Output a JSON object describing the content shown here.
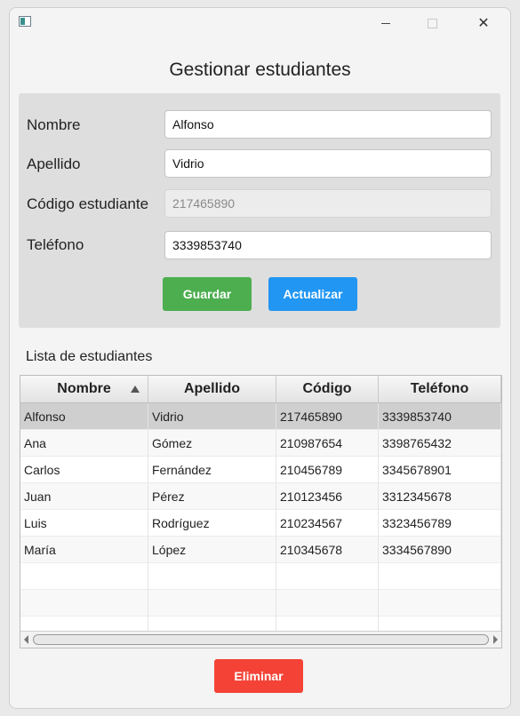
{
  "window": {
    "icon": "app-window-icon",
    "controls": {
      "minimize": "minimize-icon",
      "maximize": "maximize-icon",
      "close": "close-icon",
      "close_glyph": "✕"
    }
  },
  "title": "Gestionar estudiantes",
  "form": {
    "fields": [
      {
        "label": "Nombre",
        "value": "Alfonso",
        "disabled": false
      },
      {
        "label": "Apellido",
        "value": "Vidrio",
        "disabled": false
      },
      {
        "label": "Código estudiante",
        "value": "217465890",
        "disabled": true
      },
      {
        "label": "Teléfono",
        "value": "3339853740",
        "disabled": false
      }
    ],
    "save_label": "Guardar",
    "update_label": "Actualizar"
  },
  "list_label": "Lista de estudiantes",
  "table": {
    "columns": [
      "Nombre",
      "Apellido",
      "Código",
      "Teléfono"
    ],
    "sorted_column": "Nombre",
    "rows": [
      [
        "Alfonso",
        "Vidrio",
        "217465890",
        "3339853740"
      ],
      [
        "Ana",
        "Gómez",
        "210987654",
        "3398765432"
      ],
      [
        "Carlos",
        "Fernández",
        "210456789",
        "3345678901"
      ],
      [
        "Juan",
        "Pérez",
        "210123456",
        "3312345678"
      ],
      [
        "Luis",
        "Rodríguez",
        "210234567",
        "3323456789"
      ],
      [
        "María",
        "López",
        "210345678",
        "3334567890"
      ]
    ],
    "selected_row": 0
  },
  "delete_label": "Eliminar",
  "colors": {
    "save": "#4cae4f",
    "update": "#2196f3",
    "delete": "#f44336"
  }
}
